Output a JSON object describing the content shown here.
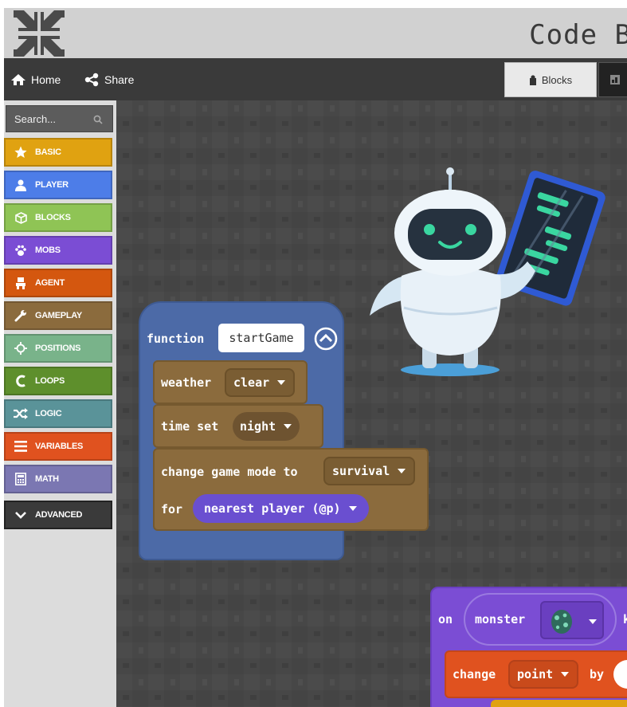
{
  "app": {
    "title": "Code B"
  },
  "menu": {
    "home_label": "Home",
    "share_label": "Share",
    "blocks_tab_label": "Blocks"
  },
  "toolbox": {
    "search_placeholder": "Search...",
    "categories": [
      {
        "label": "BASIC",
        "icon": "star-icon",
        "color": "#e0a211"
      },
      {
        "label": "PLAYER",
        "icon": "person-icon",
        "color": "#4d7de8"
      },
      {
        "label": "BLOCKS",
        "icon": "cube-icon",
        "color": "#8fc455"
      },
      {
        "label": "MOBS",
        "icon": "paw-icon",
        "color": "#7b4dd4"
      },
      {
        "label": "AGENT",
        "icon": "agent-icon",
        "color": "#d4570f"
      },
      {
        "label": "GAMEPLAY",
        "icon": "wrench-icon",
        "color": "#8b6b3d"
      },
      {
        "label": "POSITIONS",
        "icon": "crosshair-icon",
        "color": "#79b38a"
      },
      {
        "label": "LOOPS",
        "icon": "loop-icon",
        "color": "#5e8f2c"
      },
      {
        "label": "LOGIC",
        "icon": "shuffle-icon",
        "color": "#5a9399"
      },
      {
        "label": "VARIABLES",
        "icon": "lines-icon",
        "color": "#e0521f"
      },
      {
        "label": "MATH",
        "icon": "calculator-icon",
        "color": "#7b77b2"
      }
    ],
    "advanced_label": "ADVANCED"
  },
  "workspace": {
    "function_block": {
      "keyword": "function",
      "name": "startGame"
    },
    "weather_block": {
      "label": "weather",
      "value": "clear"
    },
    "time_block": {
      "label": "time set",
      "value": "night"
    },
    "gamemode_block": {
      "label": "change game mode to",
      "value": "survival",
      "for_label": "for",
      "target": "nearest player (@p)"
    },
    "event_block": {
      "on_label": "on",
      "monster_label": "monster",
      "trailing": "k"
    },
    "change_block": {
      "label": "change",
      "variable": "point",
      "by_label": "by"
    }
  },
  "colors": {
    "function": "#4c6aa7",
    "gameplay": "#8b6b3d",
    "mobs": "#7b4dd4",
    "variables": "#e0521f",
    "player": "#6a4fd0"
  }
}
